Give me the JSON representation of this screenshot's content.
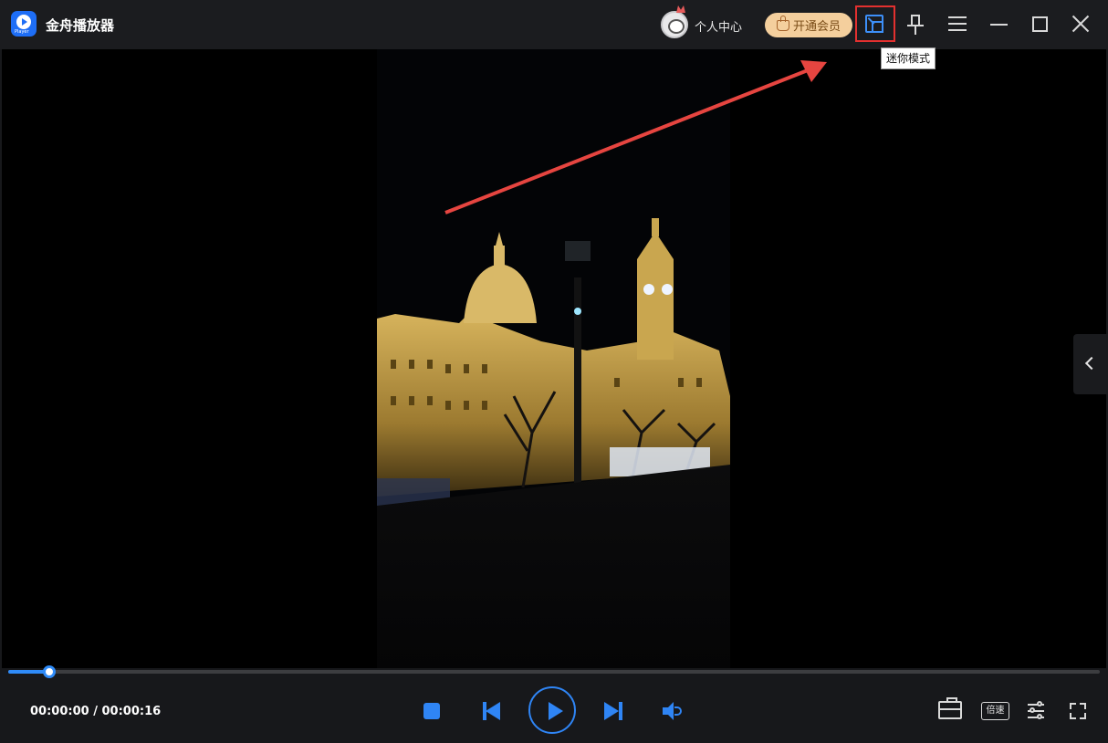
{
  "titlebar": {
    "app_name": "金舟播放器",
    "app_logo_icon": "player-logo-icon",
    "app_logo_tag": "Player",
    "user_center_label": "个人中心",
    "vip_button_label": "开通会员",
    "mini_mode_tooltip": "迷你模式",
    "buttons": [
      "mini-mode-icon",
      "pin-icon",
      "menu-icon",
      "minimize-icon",
      "maximize-icon",
      "close-icon"
    ]
  },
  "player": {
    "current_time": "00:00:00",
    "total_time": "00:00:16",
    "time_separator": " / ",
    "progress_fraction": 0.038,
    "side_panel_icon": "chevron-left-icon",
    "video_scene": "night-building-with-clock-tower"
  },
  "controls": {
    "center": [
      "stop-icon",
      "previous-icon",
      "play-icon",
      "next-icon",
      "volume-icon"
    ],
    "right": [
      "toolbox-icon",
      "speed-icon",
      "settings-icon",
      "fullscreen-icon"
    ],
    "speed_label": "倍速"
  },
  "colors": {
    "accent": "#2f85f5",
    "highlight_box": "#e3302f",
    "annotation_arrow": "#e64540",
    "vip_bg": "#f4cf9d",
    "vip_text": "#7a4d18",
    "titlebar_bg": "#1b1c1f",
    "controls_bg": "#17181b"
  }
}
